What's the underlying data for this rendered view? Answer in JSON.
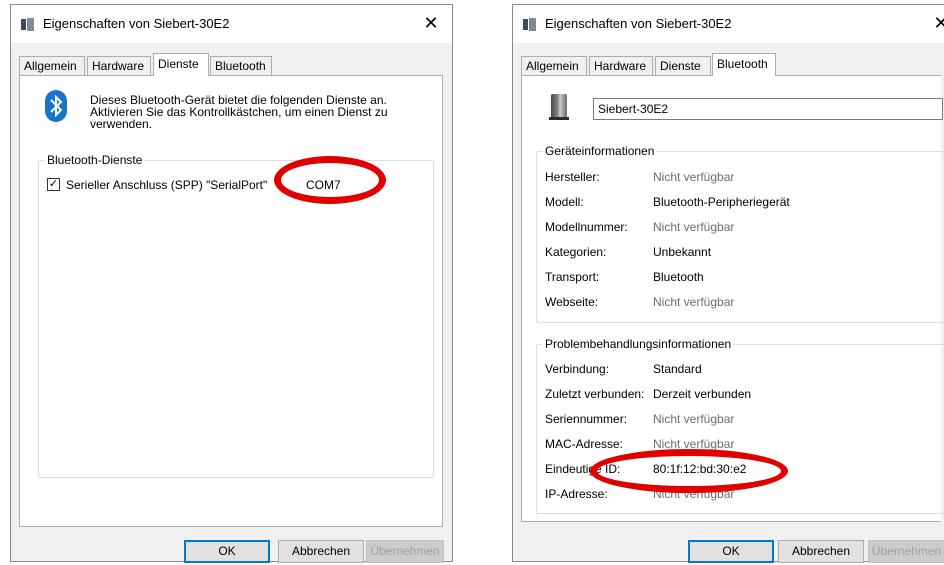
{
  "left_dialog": {
    "title": "Eigenschaften von Siebert-30E2",
    "tabs": [
      "Allgemein",
      "Hardware",
      "Dienste",
      "Bluetooth"
    ],
    "active_tab": "Dienste",
    "description": "Dieses Bluetooth-Gerät bietet die folgenden Dienste an. Aktivieren Sie das Kontrollkästchen, um einen Dienst zu verwenden.",
    "group_label": "Bluetooth-Dienste",
    "service": {
      "checkbox_mark": "✓",
      "label": "Serieller Anschluss (SPP) \"SerialPort\"",
      "port": "COM7"
    },
    "buttons": {
      "ok": "OK",
      "cancel": "Abbrechen",
      "apply": "Übernehmen"
    }
  },
  "right_dialog": {
    "title": "Eigenschaften von Siebert-30E2",
    "tabs": [
      "Allgemein",
      "Hardware",
      "Dienste",
      "Bluetooth"
    ],
    "active_tab": "Bluetooth",
    "device_name": "Siebert-30E2",
    "device_info_label": "Geräteinformationen",
    "device_info": [
      {
        "label": "Hersteller:",
        "value": "Nicht verfügbar"
      },
      {
        "label": "Modell:",
        "value": "Bluetooth-Peripheriegerät"
      },
      {
        "label": "Modellnummer:",
        "value": "Nicht verfügbar"
      },
      {
        "label": "Kategorien:",
        "value": "Unbekannt"
      },
      {
        "label": "Transport:",
        "value": "Bluetooth"
      },
      {
        "label": "Webseite:",
        "value": "Nicht verfügbar"
      }
    ],
    "troubleshooting_label": "Problembehandlungsinformationen",
    "troubleshooting": [
      {
        "label": "Verbindung:",
        "value": "Standard"
      },
      {
        "label": "Zuletzt verbunden:",
        "value": "Derzeit verbunden"
      },
      {
        "label": "Seriennummer:",
        "value": "Nicht verfügbar"
      },
      {
        "label": "MAC-Adresse:",
        "value": "Nicht verfügbar"
      },
      {
        "label": "Eindeutige ID:",
        "value": "80:1f:12:bd:30:e2"
      },
      {
        "label": "IP-Adresse:",
        "value": "Nicht verfügbar"
      }
    ],
    "buttons": {
      "ok": "OK",
      "cancel": "Abbrechen",
      "apply": "Übernehmen"
    }
  },
  "colors": {
    "highlight_ellipse": "#e00000",
    "bluetooth_blue": "#1a74c9",
    "default_button_border": "#0078d7"
  }
}
